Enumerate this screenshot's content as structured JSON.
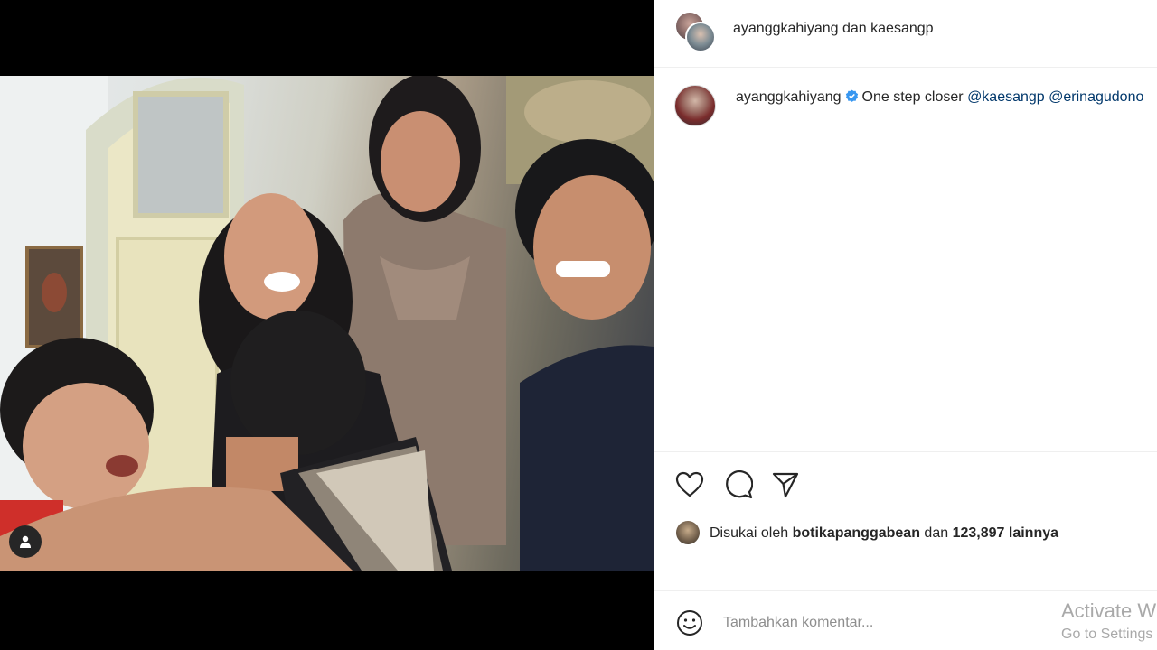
{
  "post": {
    "media": {
      "tag_button_icon": "user-tag-icon"
    },
    "header": {
      "user1": "ayanggkahiyang",
      "joiner": "dan",
      "user2": "kaesangp"
    },
    "caption": {
      "username": "ayanggkahiyang",
      "verified_icon": "verified-badge-icon",
      "text": "One step closer",
      "mention1": "@kaesangp",
      "mention2": "@erinagudono"
    },
    "actions": {
      "like_icon": "heart-icon",
      "comment_icon": "comment-icon",
      "share_icon": "send-icon"
    },
    "likes": {
      "prefix": "Disukai oleh",
      "user": "botikapanggabean",
      "joiner": "dan",
      "count": "123,897",
      "suffix": "lainnya"
    },
    "comment_box": {
      "emoji_icon": "emoji-smile-icon",
      "placeholder": "Tambahkan komentar..."
    }
  },
  "os_watermark": {
    "line1": "Activate Windows",
    "line2": "Go to Settings to activate Windows."
  },
  "colors": {
    "text": "#262626",
    "mention": "#00376b",
    "verified": "#3897f0",
    "divider": "#efefef",
    "placeholder": "#8e8e8e"
  }
}
